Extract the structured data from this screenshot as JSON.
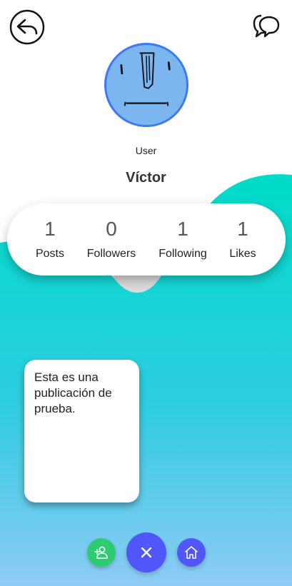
{
  "profile": {
    "role": "User",
    "name": "Víctor"
  },
  "stats": [
    {
      "value": "1",
      "label": "Posts"
    },
    {
      "value": "0",
      "label": "Followers"
    },
    {
      "value": "1",
      "label": "Following"
    },
    {
      "value": "1",
      "label": "Likes"
    }
  ],
  "posts": [
    {
      "text": "Esta es una publicación de prueba."
    }
  ],
  "icons": {
    "back": "reply-arrow-icon",
    "chat": "chat-bubbles-icon",
    "follow": "add-user-icon",
    "close": "close-icon",
    "home": "home-icon"
  },
  "colors": {
    "gradient_top": "#00dcc8",
    "gradient_bottom": "#8ecbf5",
    "avatar_fill": "#7cb6f0",
    "avatar_border": "#3d79f5",
    "follow_button": "#2ecc71",
    "primary_button": "#5056fa"
  }
}
